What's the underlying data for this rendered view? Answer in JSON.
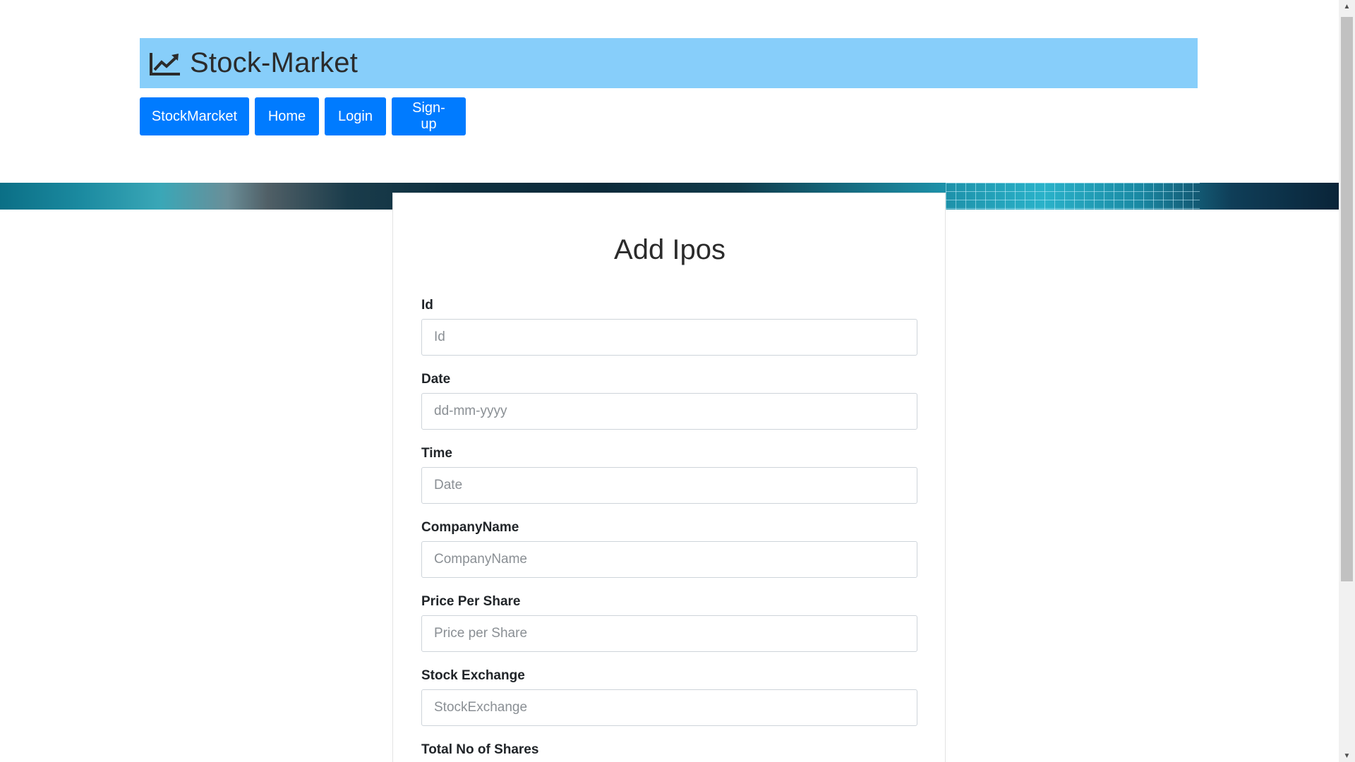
{
  "brand": {
    "title": "Stock-Market",
    "icon": "line-chart-icon",
    "bar_color": "#87cefa"
  },
  "nav": {
    "items": [
      {
        "label": "StockMarcket"
      },
      {
        "label": "Home"
      },
      {
        "label": "Login"
      },
      {
        "label": "Sign-up"
      }
    ],
    "button_color": "#007bff"
  },
  "form": {
    "title": "Add Ipos",
    "fields": [
      {
        "label": "Id",
        "placeholder": "Id",
        "value": ""
      },
      {
        "label": "Date",
        "placeholder": "dd-mm-yyyy",
        "value": ""
      },
      {
        "label": "Time",
        "placeholder": "Date",
        "value": ""
      },
      {
        "label": "CompanyName",
        "placeholder": "CompanyName",
        "value": ""
      },
      {
        "label": "Price Per Share",
        "placeholder": "Price per Share",
        "value": ""
      },
      {
        "label": "Stock Exchange",
        "placeholder": "StockExchange",
        "value": ""
      },
      {
        "label": "Total No of Shares",
        "placeholder": "",
        "value": ""
      }
    ]
  }
}
